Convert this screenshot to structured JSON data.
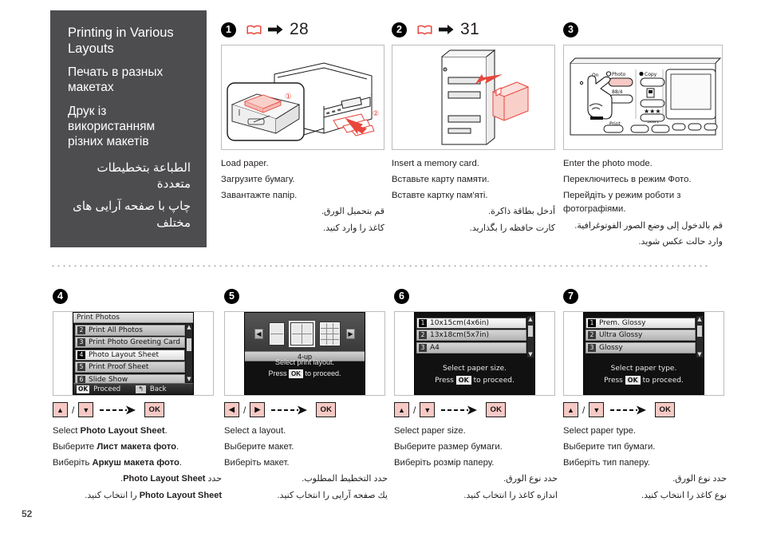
{
  "title_panel": {
    "en": "Printing in Various Layouts",
    "ru": "Печать в разных макетах",
    "uk": "Друк із використанням різних макетів",
    "ar": "الطباعة بتخطيطات متعددة",
    "fa": "چاپ با صفحه آرایی های مختلف"
  },
  "page_number": "52",
  "steps": [
    {
      "number": "1",
      "page_ref": "28",
      "has_book_ref": true,
      "caption": {
        "en": "Load paper.",
        "ru": "Загрузите бумагу.",
        "uk": "Завантажте папір.",
        "ar": "قم بتحميل الورق.",
        "fa": "کاغذ را وارد کنید."
      }
    },
    {
      "number": "2",
      "page_ref": "31",
      "has_book_ref": true,
      "caption": {
        "en": "Insert a memory card.",
        "ru": "Вставьте карту памяти.",
        "uk": "Вставте картку пам'яті.",
        "ar": "أدخل بطاقة ذاكرة.",
        "fa": "کارت حافظه را بگذارید."
      }
    },
    {
      "number": "3",
      "page_ref": "",
      "has_book_ref": false,
      "caption": {
        "en": "Enter the photo mode.",
        "ru": "Переключитесь в режим Фото.",
        "uk": "Перейдіть у режим роботи з фотографіями.",
        "ar": "قم بالدخول إلى وضع الصور الفوتوغرافية.",
        "fa": "وارد حالت عکس شوید."
      },
      "panel_labels": {
        "on": "On",
        "photo": "Photo",
        "copy": "Copy",
        "zoom": "88/4",
        "wifi": "WiFi",
        "print": "Print",
        "start": "Start"
      }
    },
    {
      "number": "4",
      "page_ref": "",
      "has_book_ref": false,
      "lcd": {
        "type": "menu",
        "title": "Print Photos",
        "items": [
          {
            "num": "2",
            "label": "Print All Photos",
            "selected": false
          },
          {
            "num": "3",
            "label": "Print Photo Greeting Card",
            "selected": false
          },
          {
            "num": "4",
            "label": "Photo Layout Sheet",
            "selected": true
          },
          {
            "num": "5",
            "label": "Print Proof Sheet",
            "selected": false
          },
          {
            "num": "6",
            "label": "Slide Show",
            "selected": false
          }
        ],
        "footer_ok": "OK",
        "footer_ok_label": "Proceed",
        "footer_back_label": "Back"
      },
      "keys": {
        "first": "▲",
        "second": "▼",
        "ok": "OK"
      },
      "caption": {
        "en_pre": "Select ",
        "en_bold": "Photo Layout Sheet",
        "en_post": ".",
        "ru_pre": "Выберите ",
        "ru_bold": "Лист макета фото",
        "ru_post": ".",
        "uk_pre": "Виберіть ",
        "uk_bold": "Аркуш макета фото",
        "uk_post": ".",
        "ar_pre": "حدد ",
        "ar_bold": "Photo Layout Sheet",
        "ar_post": ".",
        "fa_pre": "",
        "fa_bold": "Photo Layout Sheet",
        "fa_post": " را انتخاب کنید."
      }
    },
    {
      "number": "5",
      "page_ref": "",
      "has_book_ref": false,
      "lcd": {
        "type": "layout",
        "label": "4-up",
        "nav_prev": "◀",
        "nav_next": "▶",
        "msg_line1": "Select print layout.",
        "msg_pre": "Press ",
        "msg_ok": "OK",
        "msg_post": " to proceed."
      },
      "keys": {
        "first": "◀",
        "second": "▶",
        "ok": "OK"
      },
      "caption": {
        "en": "Select a layout.",
        "ru": "Выберите макет.",
        "uk": "Виберіть макет.",
        "ar": "حدد التخطيط المطلوب.",
        "fa": "يك صفحه آرایی را انتخاب کنید."
      }
    },
    {
      "number": "6",
      "page_ref": "",
      "has_book_ref": false,
      "lcd": {
        "type": "list",
        "items": [
          {
            "num": "1",
            "label": "10x15cm(4x6in)",
            "selected": true
          },
          {
            "num": "2",
            "label": "13x18cm(5x7in)",
            "selected": false
          },
          {
            "num": "3",
            "label": "A4",
            "selected": false
          }
        ],
        "msg_line1": "Select paper size.",
        "msg_pre": "Press ",
        "msg_ok": "OK",
        "msg_post": " to proceed."
      },
      "keys": {
        "first": "▲",
        "second": "▼",
        "ok": "OK"
      },
      "caption": {
        "en": "Select paper size.",
        "ru": "Выберите размер бумаги.",
        "uk": "Виберіть розмір паперу.",
        "ar": "حدد نوع الورق.",
        "fa": "اندازه کاغذ را انتخاب کنید."
      }
    },
    {
      "number": "7",
      "page_ref": "",
      "has_book_ref": false,
      "lcd": {
        "type": "list",
        "items": [
          {
            "num": "1",
            "label": "Prem. Glossy",
            "selected": true
          },
          {
            "num": "2",
            "label": "Ultra Glossy",
            "selected": false
          },
          {
            "num": "3",
            "label": "Glossy",
            "selected": false
          }
        ],
        "msg_line1": "Select paper type.",
        "msg_pre": "Press ",
        "msg_ok": "OK",
        "msg_post": " to proceed."
      },
      "keys": {
        "first": "▲",
        "second": "▼",
        "ok": "OK"
      },
      "caption": {
        "en": "Select paper type.",
        "ru": "Выберите тип бумаги.",
        "uk": "Виберіть тип паперу.",
        "ar": "حدد نوع الورق.",
        "fa": "نوع کاغذ را انتخاب کنید."
      }
    }
  ],
  "colors": {
    "panel_bg": "#4d4d4f",
    "key_bg": "#f7c9c4",
    "accent_red": "#e8463c"
  }
}
